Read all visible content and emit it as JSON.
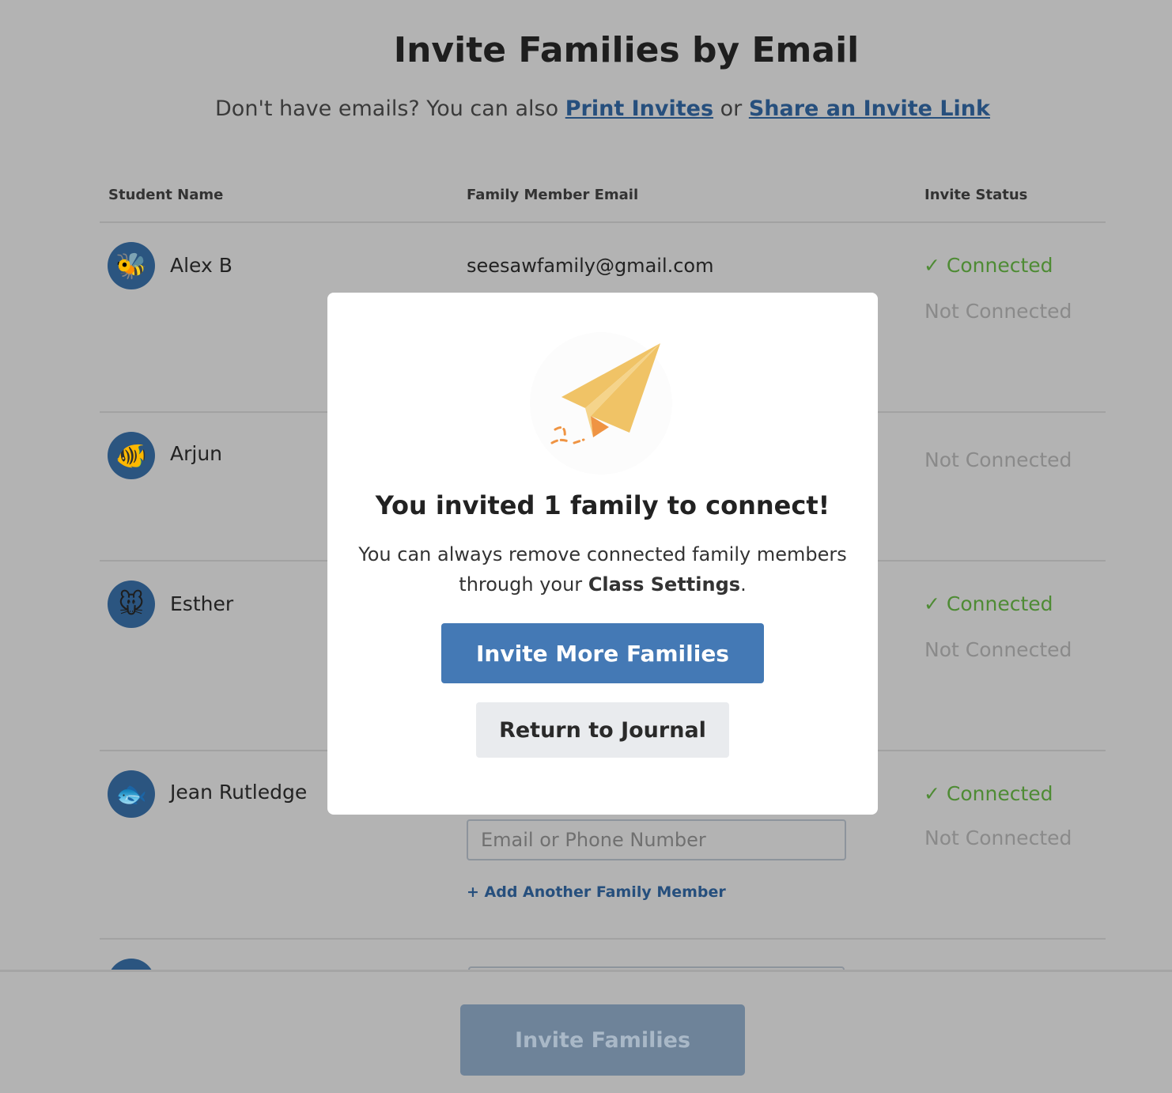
{
  "page": {
    "title": "Invite Families by Email",
    "subtitle_prefix": "Don't have emails? You can also ",
    "print_link": "Print Invites",
    "or": " or ",
    "share_link": "Share an Invite Link"
  },
  "table": {
    "headers": [
      "Student Name",
      "Family Member Email",
      "Invite Status"
    ],
    "rows": [
      {
        "name": "Alex B",
        "avatar": "bee-icon",
        "emoji": "🐝",
        "email": "seesawfamily@gmail.com",
        "statuses": [
          "Connected",
          "Not Connected"
        ]
      },
      {
        "name": "Arjun",
        "avatar": "fish-icon",
        "emoji": "🐠",
        "statuses": [
          "Not Connected"
        ]
      },
      {
        "name": "Esther",
        "avatar": "mouse-icon",
        "emoji": "🐭",
        "statuses": [
          "Connected",
          "Not Connected"
        ]
      },
      {
        "name": "Jean Rutledge",
        "avatar": "fish-icon",
        "emoji": "🐟",
        "statuses": [
          "Connected",
          "Not Connected"
        ],
        "input_placeholder": "Email or Phone Number",
        "add_link": "+ Add Another Family Member"
      }
    ]
  },
  "footer": {
    "invite_button": "Invite Families"
  },
  "modal": {
    "title": "You invited 1 family to connect!",
    "body_prefix": "You can always remove connected family members through your ",
    "body_bold": "Class Settings",
    "body_suffix": ".",
    "primary_button": "Invite More Families",
    "secondary_button": "Return to Journal"
  },
  "colors": {
    "primary": "#4479b5",
    "connected": "#4e8b34",
    "plane": "#f0c366",
    "plane_accent": "#ef9443"
  }
}
